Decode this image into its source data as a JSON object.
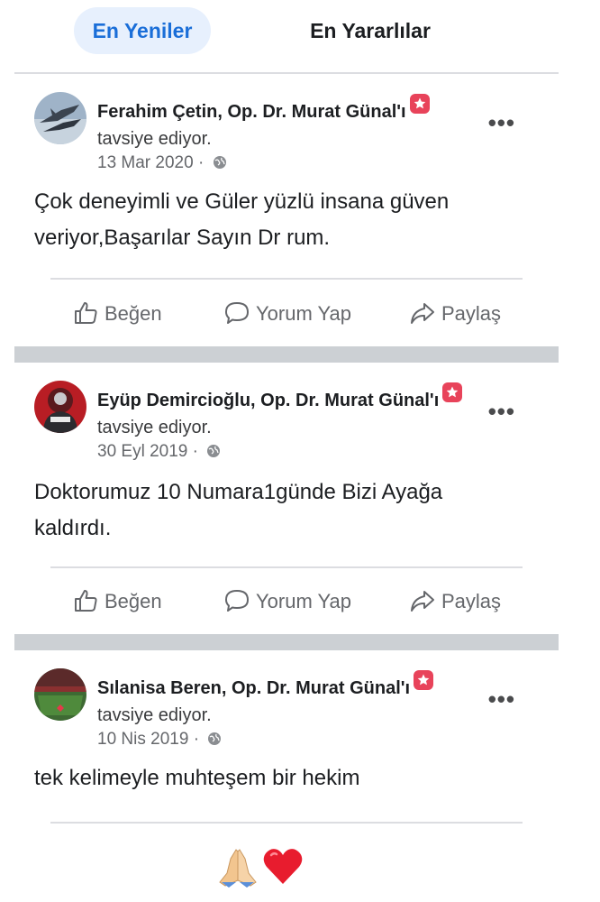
{
  "tabs": [
    {
      "label": "En Yeniler",
      "active": true
    },
    {
      "label": "En Yararlılar",
      "active": false
    }
  ],
  "posts": [
    {
      "name": "Ferahim Çetin, Op. Dr. Murat Günal'ı",
      "subline": "tavsiye ediyor.",
      "date": "13 Mar 2020",
      "separator": "·",
      "body_lines": [
        "Çok deneyimli ve Güler yüzlü insana güven",
        "veriyor,Başarılar Sayın Dr rum."
      ]
    },
    {
      "name": "Eyüp Demircioğlu, Op. Dr. Murat Günal'ı",
      "subline": "tavsiye ediyor.",
      "date": "30 Eyl 2019",
      "separator": "·",
      "body_lines": [
        "Doktorumuz 10 Numara1günde Bizi Ayağa",
        "kaldırdı."
      ]
    },
    {
      "name": "Sılanisa Beren, Op. Dr. Murat Günal'ı",
      "subline": "tavsiye ediyor.",
      "date": "10 Nis 2019",
      "separator": "·",
      "body_lines": [
        "tek kelimeyle  muhteşem bir hekim"
      ]
    }
  ],
  "actions": {
    "like": "Beğen",
    "comment": "Yorum Yap",
    "share": "Paylaş"
  },
  "more_label": "•••",
  "emojis": [
    "pray-hands-emoji",
    "red-heart-emoji"
  ],
  "colors": {
    "accent": "#1a6ed8",
    "tab_active_bg": "#e7f0fd",
    "recommend_icon": "#e8435a",
    "separator": "#ccd0d4",
    "muted_text": "#65676b"
  }
}
